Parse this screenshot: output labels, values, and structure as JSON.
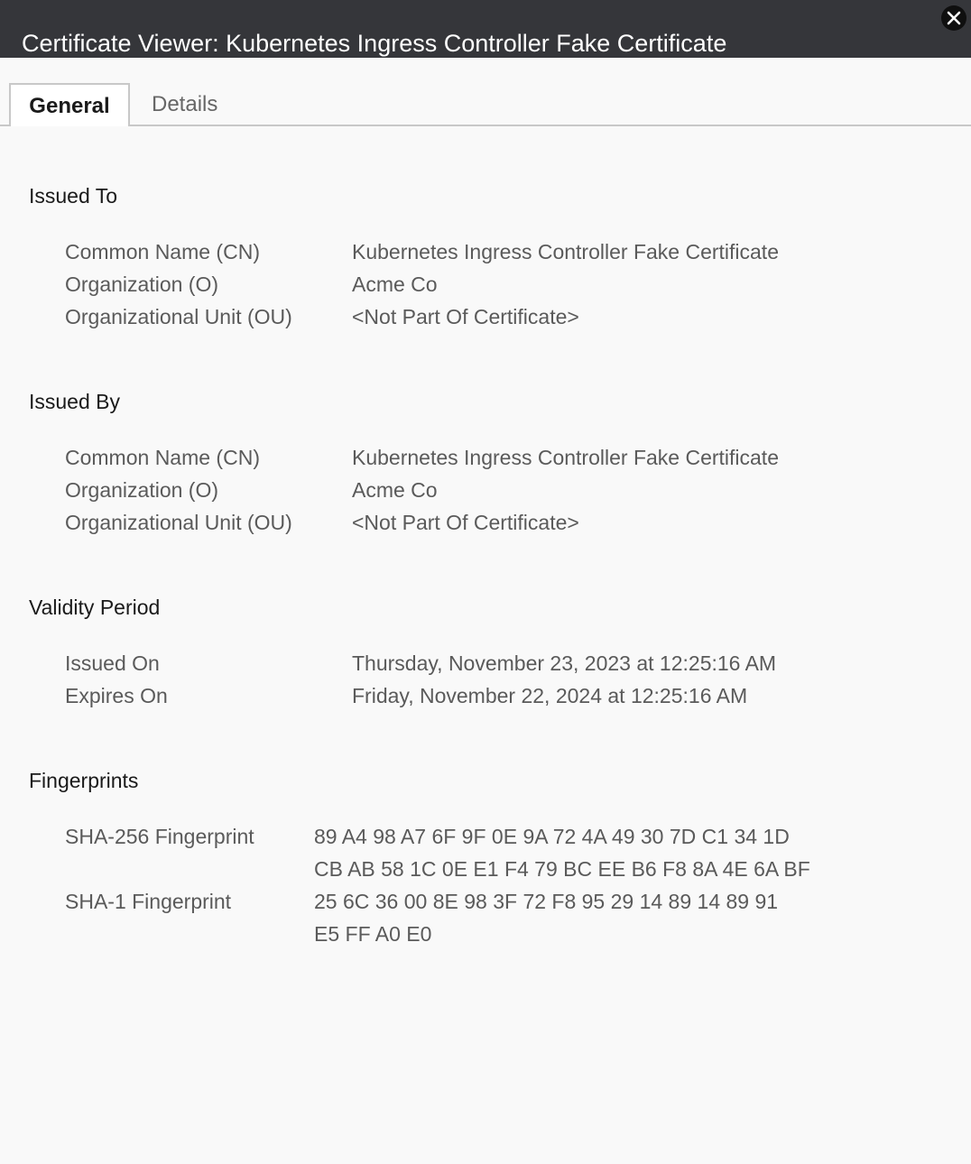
{
  "window": {
    "title": "Certificate Viewer: Kubernetes Ingress Controller Fake Certificate",
    "close_icon": "close-icon"
  },
  "tabs": [
    {
      "label": "General",
      "selected": true
    },
    {
      "label": "Details",
      "selected": false
    }
  ],
  "issued_to": {
    "heading": "Issued To",
    "rows": [
      {
        "label": "Common Name (CN)",
        "value": "Kubernetes Ingress Controller Fake Certificate"
      },
      {
        "label": "Organization (O)",
        "value": "Acme Co"
      },
      {
        "label": "Organizational Unit (OU)",
        "value": "<Not Part Of Certificate>"
      }
    ]
  },
  "issued_by": {
    "heading": "Issued By",
    "rows": [
      {
        "label": "Common Name (CN)",
        "value": "Kubernetes Ingress Controller Fake Certificate"
      },
      {
        "label": "Organization (O)",
        "value": "Acme Co"
      },
      {
        "label": "Organizational Unit (OU)",
        "value": "<Not Part Of Certificate>"
      }
    ]
  },
  "validity": {
    "heading": "Validity Period",
    "rows": [
      {
        "label": "Issued On",
        "value": "Thursday, November 23, 2023 at 12:25:16 AM"
      },
      {
        "label": "Expires On",
        "value": "Friday, November 22, 2024 at 12:25:16 AM"
      }
    ]
  },
  "fingerprints": {
    "heading": "Fingerprints",
    "sha256": {
      "label": "SHA-256 Fingerprint",
      "lines": [
        "89 A4 98 A7 6F 9F 0E 9A 72 4A 49 30 7D C1 34 1D",
        "CB AB 58 1C 0E E1 F4 79 BC EE B6 F8 8A 4E 6A BF"
      ]
    },
    "sha1": {
      "label": "SHA-1 Fingerprint",
      "lines": [
        "25 6C 36 00 8E 98 3F 72 F8 95 29 14 89 14 89 91",
        "E5 FF A0 E0"
      ]
    }
  }
}
